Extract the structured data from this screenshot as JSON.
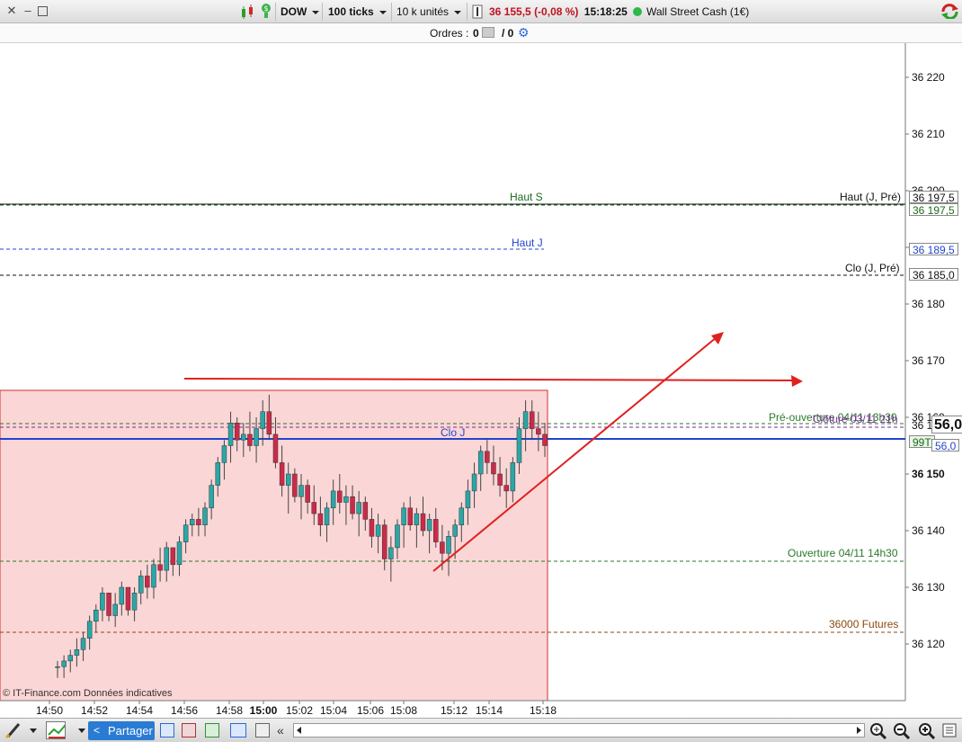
{
  "toolbar": {
    "instrument": "DOW",
    "ticks": "100 ticks",
    "units": "10 k unités",
    "price": "36 155,5",
    "change": "(-0,08 %)",
    "time": "15:18:25",
    "market_name": "Wall Street Cash (1€)",
    "status_color": "#2db84a",
    "change_color": "#c0121f"
  },
  "orders": {
    "label": "Ordres :",
    "count_a": "0",
    "count_b": "/ 0"
  },
  "chart_data": {
    "type": "candlestick",
    "y_range": [
      36116,
      36227
    ],
    "y_ticks": [
      "36 220",
      "36 210",
      "36 200",
      "36 190",
      "36 180",
      "36 170",
      "36 160",
      "36 150",
      "36 140",
      "36 130",
      "36 120"
    ],
    "y_tick_values": [
      36220,
      36210,
      36200,
      36190,
      36180,
      36170,
      36160,
      36150,
      36140,
      36130,
      36120
    ],
    "bold_tick": "36 150",
    "x_ticks": [
      "14:50",
      "14:52",
      "14:54",
      "14:56",
      "14:58",
      "15:00",
      "15:02",
      "15:04",
      "15:06",
      "15:08",
      "15:12",
      "15:14",
      "15:18"
    ],
    "bold_x_tick": "15:00",
    "levels": [
      {
        "label": "Haut S",
        "color": "#1a6b1a"
      },
      {
        "label": "Haut (J, Pré)",
        "color": "#111111"
      },
      {
        "label": "Haut J",
        "color": "#2244cc"
      },
      {
        "label": "Clo (J, Pré)",
        "color": "#111111"
      },
      {
        "label": "Pré-ouverture 04/11 13h30",
        "color": "#2a7a2a"
      },
      {
        "label": "Clôture 03/11 21h",
        "color": "#7a2a9a"
      },
      {
        "label": "Clo J",
        "color": "#2244cc"
      },
      {
        "label": "Ouverture 04/11 14h30",
        "color": "#2a7a2a"
      },
      {
        "label": "36000 Futures",
        "color": "#8a4a10"
      }
    ],
    "price_labels": [
      {
        "text": "36 197,5",
        "color": "#111111"
      },
      {
        "text": "36 197,5",
        "color": "#1a6b1a"
      },
      {
        "text": "36 189,5",
        "color": "#2244cc"
      },
      {
        "text": "36 185,0",
        "color": "#111111"
      },
      {
        "text": "36 1",
        "color": "#111111"
      },
      {
        "text": "56,0",
        "color": "#111111"
      },
      {
        "text": "99T",
        "color": "#1a6b1a"
      },
      {
        "text": "56,0",
        "color": "#2244cc"
      }
    ],
    "up_color": "#2aa7a8",
    "down_color": "#cc2a4a",
    "candles": [
      [
        36116,
        36117,
        36114,
        36116
      ],
      [
        36116,
        36118,
        36114,
        36117
      ],
      [
        36117,
        36119,
        36115,
        36118
      ],
      [
        36118,
        36121,
        36116,
        36119
      ],
      [
        36119,
        36122,
        36117,
        36121
      ],
      [
        36121,
        36125,
        36119,
        36124
      ],
      [
        36124,
        36127,
        36122,
        36126
      ],
      [
        36126,
        36130,
        36124,
        36129
      ],
      [
        36129,
        36128,
        36124,
        36125
      ],
      [
        36125,
        36129,
        36123,
        36127
      ],
      [
        36127,
        36131,
        36125,
        36130
      ],
      [
        36130,
        36129,
        36125,
        36126
      ],
      [
        36126,
        36130,
        36124,
        36129
      ],
      [
        36129,
        36133,
        36127,
        36132
      ],
      [
        36132,
        36134,
        36128,
        36130
      ],
      [
        36130,
        36135,
        36128,
        36134
      ],
      [
        36134,
        36137,
        36131,
        36133
      ],
      [
        36133,
        36138,
        36131,
        36137
      ],
      [
        36137,
        36136,
        36132,
        36134
      ],
      [
        36134,
        36139,
        36132,
        36138
      ],
      [
        36138,
        36142,
        36136,
        36141
      ],
      [
        36141,
        36143,
        36139,
        36142
      ],
      [
        36142,
        36144,
        36139,
        36141
      ],
      [
        36141,
        36145,
        36139,
        36144
      ],
      [
        36144,
        36149,
        36142,
        36148
      ],
      [
        36148,
        36153,
        36146,
        36152
      ],
      [
        36152,
        36156,
        36149,
        36155
      ],
      [
        36155,
        36161,
        36152,
        36159
      ],
      [
        36159,
        36160,
        36154,
        36156
      ],
      [
        36156,
        36159,
        36153,
        36157
      ],
      [
        36157,
        36161,
        36154,
        36155
      ],
      [
        36155,
        36160,
        36152,
        36158
      ],
      [
        36158,
        36163,
        36155,
        36161
      ],
      [
        36161,
        36164,
        36156,
        36157
      ],
      [
        36157,
        36160,
        36151,
        36152
      ],
      [
        36152,
        36155,
        36146,
        36148
      ],
      [
        36148,
        36152,
        36143,
        36150
      ],
      [
        36150,
        36151,
        36145,
        36146
      ],
      [
        36146,
        36150,
        36142,
        36148
      ],
      [
        36148,
        36149,
        36143,
        36145
      ],
      [
        36145,
        36148,
        36141,
        36143
      ],
      [
        36143,
        36146,
        36139,
        36141
      ],
      [
        36141,
        36145,
        36138,
        36144
      ],
      [
        36144,
        36149,
        36141,
        36147
      ],
      [
        36147,
        36150,
        36143,
        36145
      ],
      [
        36145,
        36148,
        36141,
        36146
      ],
      [
        36146,
        36148,
        36142,
        36143
      ],
      [
        36143,
        36147,
        36139,
        36145
      ],
      [
        36145,
        36146,
        36140,
        36142
      ],
      [
        36142,
        36144,
        36137,
        36139
      ],
      [
        36139,
        36143,
        36136,
        36141
      ],
      [
        36141,
        36142,
        36133,
        36135
      ],
      [
        36135,
        36139,
        36131,
        36137
      ],
      [
        36137,
        36142,
        36135,
        36141
      ],
      [
        36141,
        36145,
        36137,
        36144
      ],
      [
        36144,
        36146,
        36140,
        36141
      ],
      [
        36141,
        36144,
        36137,
        36143
      ],
      [
        36143,
        36146,
        36139,
        36140
      ],
      [
        36140,
        36143,
        36136,
        36142
      ],
      [
        36142,
        36144,
        36137,
        36138
      ],
      [
        36138,
        36141,
        36133,
        36136
      ],
      [
        36136,
        36140,
        36132,
        36139
      ],
      [
        36139,
        36142,
        36135,
        36141
      ],
      [
        36141,
        36145,
        36138,
        36144
      ],
      [
        36144,
        36149,
        36141,
        36147
      ],
      [
        36147,
        36152,
        36144,
        36150
      ],
      [
        36150,
        36155,
        36147,
        36154
      ],
      [
        36154,
        36156,
        36150,
        36152
      ],
      [
        36152,
        36155,
        36148,
        36150
      ],
      [
        36150,
        36153,
        36146,
        36148
      ],
      [
        36148,
        36151,
        36144,
        36147
      ],
      [
        36147,
        36153,
        36145,
        36152
      ],
      [
        36152,
        36160,
        36150,
        36158
      ],
      [
        36158,
        36163,
        36154,
        36161
      ],
      [
        36161,
        36163,
        36156,
        36158
      ],
      [
        36158,
        36161,
        36154,
        36157
      ],
      [
        36157,
        36159,
        36153,
        36155
      ]
    ]
  },
  "copyright": "© IT-Finance.com  Données indicatives",
  "bottombar": {
    "share_label": "Partager",
    "collapse_label": "«"
  }
}
